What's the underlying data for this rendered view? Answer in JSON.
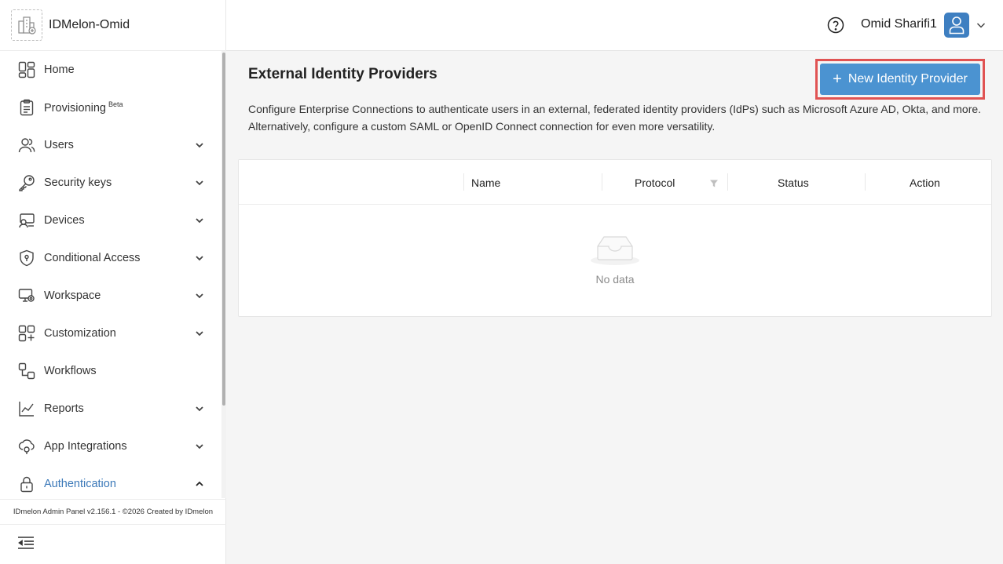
{
  "brand": {
    "name": "IDMelon-Omid"
  },
  "header": {
    "user_name": "Omid Sharifi1"
  },
  "sidebar": {
    "items": [
      {
        "label": "Home",
        "icon": "home-icon",
        "expandable": false
      },
      {
        "label": "Provisioning",
        "badge": "Beta",
        "icon": "clipboard-icon",
        "expandable": false
      },
      {
        "label": "Users",
        "icon": "users-icon",
        "expandable": true
      },
      {
        "label": "Security keys",
        "icon": "key-icon",
        "expandable": true
      },
      {
        "label": "Devices",
        "icon": "devices-icon",
        "expandable": true
      },
      {
        "label": "Conditional Access",
        "icon": "shield-icon",
        "expandable": true
      },
      {
        "label": "Workspace",
        "icon": "workspace-icon",
        "expandable": true
      },
      {
        "label": "Customization",
        "icon": "customization-icon",
        "expandable": true
      },
      {
        "label": "Workflows",
        "icon": "workflows-icon",
        "expandable": false
      },
      {
        "label": "Reports",
        "icon": "reports-icon",
        "expandable": true
      },
      {
        "label": "App Integrations",
        "icon": "app-integrations-icon",
        "expandable": true
      },
      {
        "label": "Authentication",
        "icon": "lock-icon",
        "expandable": true,
        "active": true
      }
    ],
    "footer": "IDmelon Admin Panel v2.156.1 - ©2026 Created by IDmelon"
  },
  "main": {
    "title": "External Identity Providers",
    "new_button_label": "New Identity Provider",
    "description": "Configure Enterprise Connections to authenticate users in an external, federated identity providers (IdPs) such as Microsoft Azure AD, Okta, and more. Alternatively, configure a custom SAML or OpenID Connect connection for even more versatility.",
    "table": {
      "columns": [
        "Name",
        "Protocol",
        "Status",
        "Action"
      ],
      "empty_text": "No data"
    }
  },
  "colors": {
    "accent": "#4b93d1",
    "active_menu": "#3a78b8",
    "highlight_border": "#e05353",
    "avatar": "#3e7fc1"
  }
}
